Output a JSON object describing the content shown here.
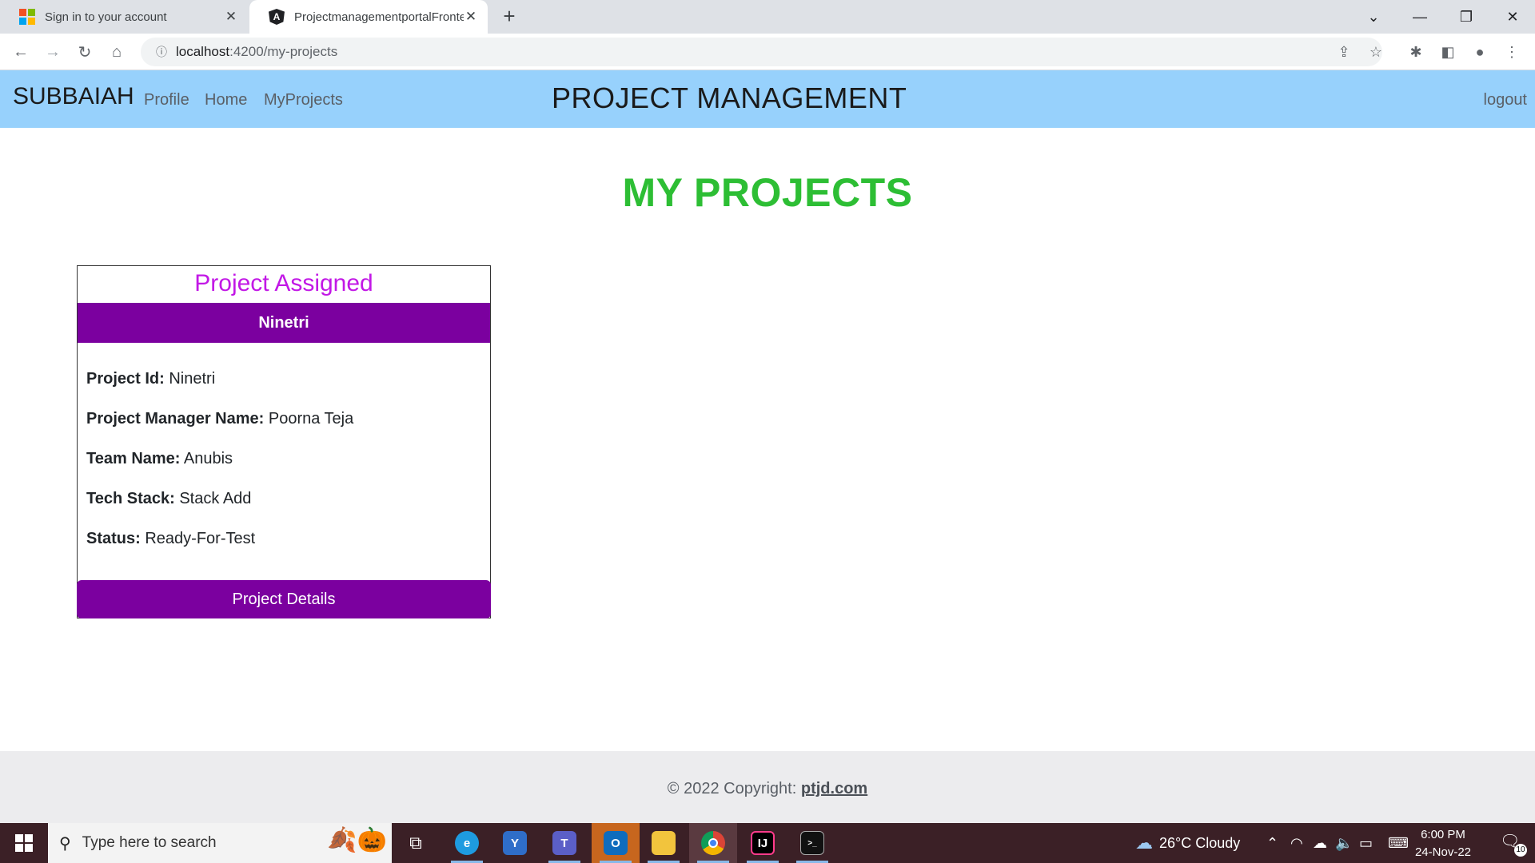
{
  "browser": {
    "tabs": [
      {
        "title": "Sign in to your account",
        "icon": "microsoft-icon",
        "active": false
      },
      {
        "title": "ProjectmanagementportalFronte",
        "icon": "angular-icon",
        "active": true
      }
    ],
    "new_tab": "+",
    "address": {
      "host": "localhost",
      "path": ":4200/my-projects"
    }
  },
  "navbar": {
    "brand": "SUBBAIAH",
    "links": [
      "Profile",
      "Home",
      "MyProjects"
    ],
    "title": "PROJECT MANAGEMENT",
    "logout": "logout",
    "bg_color": "#97d1fc"
  },
  "page": {
    "heading": "MY PROJECTS",
    "heading_color": "#2dbe34"
  },
  "card": {
    "title": "Project Assigned",
    "header": "Ninetri",
    "fields": [
      {
        "label": "Project Id:",
        "value": "Ninetri"
      },
      {
        "label": "Project Manager Name:",
        "value": "Poorna Teja"
      },
      {
        "label": "Team Name:",
        "value": "Anubis"
      },
      {
        "label": "Tech Stack:",
        "value": "Stack Add"
      },
      {
        "label": "Status:",
        "value": "Ready-For-Test"
      }
    ],
    "button": "Project Details",
    "accent_color": "#7b009f",
    "title_color": "#c218e6"
  },
  "footer": {
    "copyright": "© 2022 Copyright: ",
    "link": "ptjd.com"
  },
  "taskbar": {
    "search_placeholder": "Type here to search",
    "weather": "26°C  Cloudy",
    "time": "6:00 PM",
    "date": "24-Nov-22",
    "notifications": "10"
  }
}
